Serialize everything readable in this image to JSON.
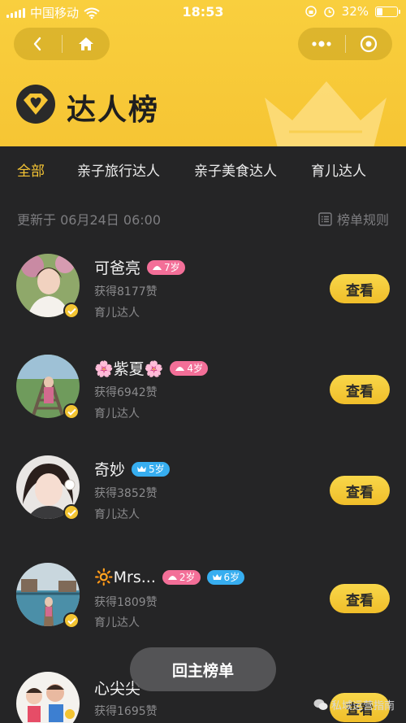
{
  "status_bar": {
    "carrier": "中国移动",
    "time": "18:53",
    "battery": "32%",
    "battery_level": 0.32
  },
  "header": {
    "title": "达人榜",
    "logo_icon": "diamond-heart-icon",
    "colors": {
      "accent": "#f6c534",
      "background": "#252526"
    }
  },
  "tabs": [
    {
      "label": "全部",
      "active": true
    },
    {
      "label": "亲子旅行达人",
      "active": false
    },
    {
      "label": "亲子美食达人",
      "active": false
    },
    {
      "label": "育儿达人",
      "active": false
    }
  ],
  "updated_text": "更新于 06月24日 06:00",
  "rules_label": "榜单规则",
  "items": [
    {
      "name": "可爸亮",
      "tags": [
        {
          "text": "7岁",
          "color": "pink",
          "icon": "hat-icon"
        }
      ],
      "likes": "获得8177赞",
      "category": "育儿达人",
      "button": "查看"
    },
    {
      "name": "🌸紫夏🌸",
      "tags": [
        {
          "text": "4岁",
          "color": "pink",
          "icon": "hat-icon"
        }
      ],
      "likes": "获得6942赞",
      "category": "育儿达人",
      "button": "查看"
    },
    {
      "name": "奇妙",
      "tags": [
        {
          "text": "5岁",
          "color": "blue",
          "icon": "crown-icon"
        }
      ],
      "likes": "获得3852赞",
      "category": "育儿达人",
      "button": "查看"
    },
    {
      "name": "🔆Mrs...",
      "tags": [
        {
          "text": "2岁",
          "color": "pink",
          "icon": "hat-icon"
        },
        {
          "text": "6岁",
          "color": "blue",
          "icon": "crown-icon"
        }
      ],
      "likes": "获得1809赞",
      "category": "育儿达人",
      "button": "查看"
    },
    {
      "name": "心尖尖",
      "tags": [],
      "likes": "获得1695赞",
      "category": "",
      "button": "查看"
    }
  ],
  "back_main_label": "回主榜单",
  "watermark": "私域运营指南"
}
